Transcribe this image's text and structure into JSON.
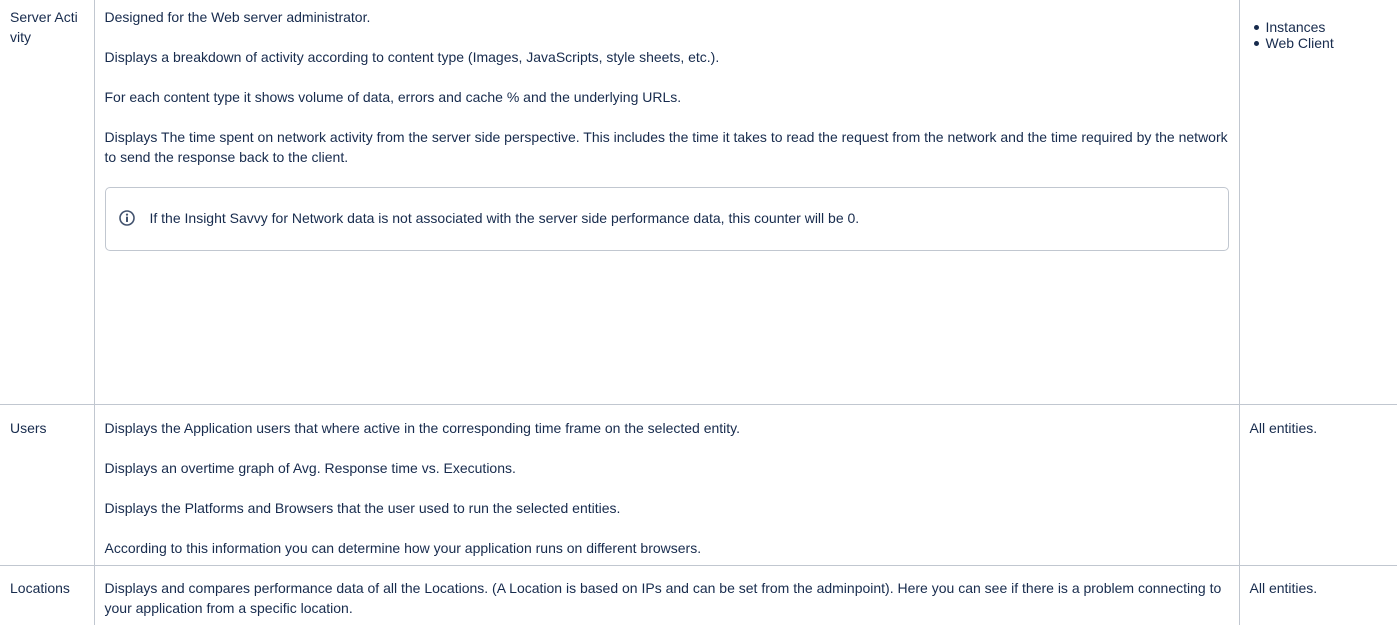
{
  "rows": [
    {
      "name": "Server Activity",
      "paragraphs": [
        "Designed for the Web server administrator.",
        "Displays a breakdown of activity according to content type (Images, JavaScripts, style sheets, etc.).",
        "For each content type it shows volume of data, errors and cache % and the underlying URLs.",
        "Displays The time spent on network activity from the server side perspective. This includes the time it takes to read the request from the network and the time required by the network to send the response back to the client."
      ],
      "info_note": "If the Insight Savvy for Network data is not associated with the server side performance data, this counter will be 0.",
      "applies_to": [
        "Instances",
        "Web Client"
      ]
    },
    {
      "name": "Users",
      "paragraphs": [
        "Displays the Application users that where active in the corresponding time frame on the selected entity.",
        "Displays an overtime graph of Avg. Response time vs. Executions.",
        "Displays the Platforms and Browsers that the user used to run the selected entities.",
        "According to this information you can determine how your application runs on different browsers."
      ],
      "applies_to_text": "All entities."
    },
    {
      "name": "Locations",
      "paragraphs": [
        "Displays and compares performance data of all the Locations. (A Location is based on IPs and can be set from the adminpoint). Here you can see if there is a problem connecting to your application from a specific location."
      ],
      "applies_to_text": "All entities."
    }
  ],
  "colors": {
    "text": "#172b4d",
    "border": "#c1c7d0",
    "info_icon": "#42526e"
  },
  "icons": {
    "info": "info-circle-icon"
  }
}
